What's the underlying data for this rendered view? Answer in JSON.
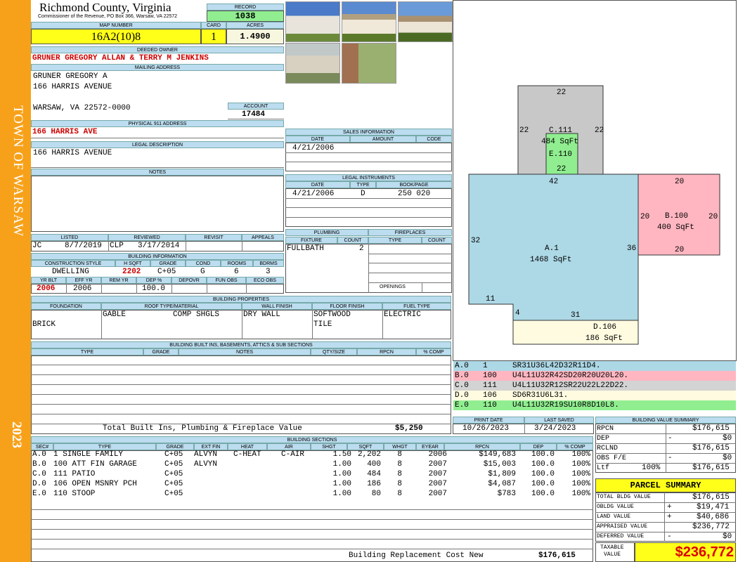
{
  "sidebar": {
    "town": "TOWN OF WARSAW",
    "year": "2023"
  },
  "header": {
    "county": "Richmond County, Virginia",
    "address": "Commissioner of the Revenue, PO Box 366, Warsaw, VA 22572",
    "record_label": "RECORD",
    "record": "1038",
    "map_label": "MAP NUMBER",
    "map": "16A2(10)8",
    "card_label": "CARD",
    "card": "1",
    "acres_label": "ACRES",
    "acres": "1.4900"
  },
  "owner": {
    "deeded_label": "DEEDED OWNER",
    "deeded": "GRUNER GREGORY ALLAN & TERRY M JENKINS",
    "mailing_label": "MAILING ADDRESS",
    "mail1": "GRUNER GREGORY A",
    "mail2": "166 HARRIS AVENUE",
    "mail3": "WARSAW, VA 22572-0000",
    "account_label": "ACCOUNT",
    "account": "17484",
    "phys_label": "PHYSICAL 911 ADDRESS",
    "phys": "166 HARRIS AVE",
    "legal_label": "LEGAL DESCRIPTION",
    "legal": "166 HARRIS AVENUE",
    "notes_label": "NOTES"
  },
  "sales": {
    "label": "SALES INFORMATION",
    "h_date": "DATE",
    "h_amount": "AMOUNT",
    "h_code": "CODE",
    "date": "4/21/2006"
  },
  "legal_inst": {
    "label": "LEGAL INSTRUMENTS",
    "h_date": "DATE",
    "h_type": "TYPE",
    "h_bp": "BOOK/PAGE",
    "date": "4/21/2006",
    "type": "D",
    "bp": "250 020"
  },
  "listed": {
    "listed_label": "LISTED",
    "reviewed_label": "REVIEWED",
    "revisit_label": "REVISIT",
    "appeals_label": "APPEALS",
    "listed_by": "JC",
    "listed_date": "8/7/2019",
    "reviewed_by": "CLP",
    "reviewed_date": "3/17/2014"
  },
  "building": {
    "label": "BUILDING INFORMATION",
    "h_style": "CONSTRUCTION STYLE",
    "h_hsqft": "H SQFT",
    "h_grade": "GRADE",
    "h_cond": "COND",
    "h_rooms": "ROOMS",
    "h_bdrms": "BDRMS",
    "style": "DWELLING",
    "hsqft": "2202",
    "grade": "C+05",
    "cond": "G",
    "rooms": "6",
    "bdrms": "3",
    "h_yrblt": "YR BLT",
    "h_effyr": "EFF YR",
    "h_remyr": "REM YR",
    "h_dep": "DEP %",
    "h_depovr": "DEPOVR",
    "h_funobs": "FUN OBS",
    "h_ecoobs": "ECO OBS",
    "yrblt": "2006",
    "effyr": "2006",
    "dep": "100.0"
  },
  "plumbing": {
    "label": "PLUMBING",
    "h_fixture": "FIXTURE",
    "h_count": "COUNT",
    "fixture": "FULLBATH",
    "count": "2"
  },
  "fireplaces": {
    "label": "FIREPLACES",
    "h_type": "TYPE",
    "h_count": "COUNT",
    "openings": "OPENINGS"
  },
  "props": {
    "label": "BUILDING PROPERTIES",
    "h_found": "FOUNDATION",
    "h_roof": "ROOF TYPE/MATERIAL",
    "h_wall": "WALL FINISH",
    "h_floor": "FLOOR FINISH",
    "h_fuel": "FUEL TYPE",
    "found": "BRICK",
    "roof1": "GABLE",
    "roof2": "COMP SHGLS",
    "wall": "DRY WALL",
    "floor1": "SOFTWOOD",
    "floor2": "TILE",
    "fuel": "ELECTRIC"
  },
  "builtins": {
    "label": "BUILDING BUILT INS, BASEMENTS, ATTICS & SUB SECTIONS",
    "h_type": "TYPE",
    "h_grade": "GRADE",
    "h_notes": "NOTES",
    "h_qty": "QTY/SIZE",
    "h_rpcn": "RPCN",
    "h_comp": "% COMP",
    "total_label": "Total Built Ins, Plumbing & Fireplace Value",
    "total": "$5,250"
  },
  "sections": {
    "label": "BUILDING SECTIONS",
    "headers": [
      "SEC#",
      "TYPE",
      "GRADE",
      "EXT FIN",
      "HEAT",
      "AIR",
      "SHGT",
      "SQFT",
      "WHGT",
      "EYEAR",
      "RPCN",
      "DEP",
      "% COMP"
    ],
    "rows": [
      [
        "A.0",
        "1 SINGLE FAMILY",
        "C+05",
        "ALVYN",
        "C-HEAT",
        "C-AIR",
        "1.50",
        "2,202",
        "8",
        "2006",
        "$149,683",
        "100.0",
        "100%"
      ],
      [
        "B.0",
        "100 ATT FIN GARAGE",
        "C+05",
        "ALVYN",
        "",
        "",
        "1.00",
        "400",
        "8",
        "2007",
        "$15,003",
        "100.0",
        "100%"
      ],
      [
        "C.0",
        "111 PATIO",
        "C+05",
        "",
        "",
        "",
        "1.00",
        "484",
        "8",
        "2007",
        "$1,809",
        "100.0",
        "100%"
      ],
      [
        "D.0",
        "106 OPEN MSNRY PCH",
        "C+05",
        "",
        "",
        "",
        "1.00",
        "186",
        "8",
        "2007",
        "$4,087",
        "100.0",
        "100%"
      ],
      [
        "E.0",
        "110 STOOP",
        "C+05",
        "",
        "",
        "",
        "1.00",
        "80",
        "8",
        "2007",
        "$783",
        "100.0",
        "100%"
      ]
    ],
    "replacement_label": "Building Replacement Cost New",
    "replacement": "$176,615"
  },
  "sketch": {
    "labels": {
      "c_top": "22",
      "c_left": "22",
      "c_right": "22",
      "c_name": "C.111",
      "c_area": "484 SqFt",
      "e_name": "E.110",
      "e_bottom": "22",
      "a_top": "42",
      "a_left": "32",
      "a_right": "36",
      "a_name": "A.1",
      "a_area": "1468 SqFt",
      "a_b1": "11",
      "a_b2": "4",
      "a_b3": "31",
      "b_top": "20",
      "b_left": "20",
      "b_right": "20",
      "b_bottom": "20",
      "b_name": "B.100",
      "b_area": "400 SqFt",
      "d_name": "D.106",
      "d_area": "186 SqFt"
    },
    "colors": {
      "a": "#add8e6",
      "b": "#ffb6c1",
      "c": "#c8c8c8",
      "d": "#fffbe0",
      "e": "#90ee90"
    }
  },
  "codes": [
    {
      "sec": "A.0",
      "num": "1",
      "code": "SR31U36L42D32R11D4.",
      "color": "#add8e6"
    },
    {
      "sec": "B.0",
      "num": "100",
      "code": "U4L11U32R42SD20R20U20L20.",
      "color": "#ffb6c1"
    },
    {
      "sec": "C.0",
      "num": "111",
      "code": "U4L11U32R12SR22U22L22D22.",
      "color": "#d3d3d3"
    },
    {
      "sec": "D.0",
      "num": "106",
      "code": "SD6R31U6L31.",
      "color": "#fffbe0"
    },
    {
      "sec": "E.0",
      "num": "110",
      "code": "U4L11U32R19SU10R8D10L8.",
      "color": "#90ee90"
    }
  ],
  "dates": {
    "print_label": "PRINT DATE",
    "print": "10/26/2023",
    "saved_label": "LAST SAVED",
    "saved": "3/24/2023"
  },
  "bvs": {
    "label": "BUILDING VALUE SUMMARY",
    "rpcn_l": "RPCN",
    "rpcn": "$176,615",
    "dep_l": "DEP",
    "dep_sign": "-",
    "dep": "$0",
    "rclnd_l": "RCLND",
    "rclnd": "$176,615",
    "obs_l": "OBS F/E",
    "obs_sign": "-",
    "obs": "$0",
    "ltf_l": "Ltf",
    "ltf_pct": "100%",
    "ltf": "$176,615"
  },
  "parcel": {
    "label": "PARCEL SUMMARY",
    "tbv_l": "TOTAL BLDG VALUE",
    "tbv": "$176,615",
    "obldg_l": "OBLDG VALUE",
    "obldg_sign": "+",
    "obldg": "$19,471",
    "land_l": "LAND VALUE",
    "land_sign": "+",
    "land": "$40,686",
    "appr_l": "APPRAISED VALUE",
    "appr": "$236,772",
    "def_l": "DEFERRED VALUE",
    "def_sign": "-",
    "def": "$0",
    "tax_l1": "TAXABLE",
    "tax_l2": "VALUE",
    "tax": "$236,772"
  }
}
